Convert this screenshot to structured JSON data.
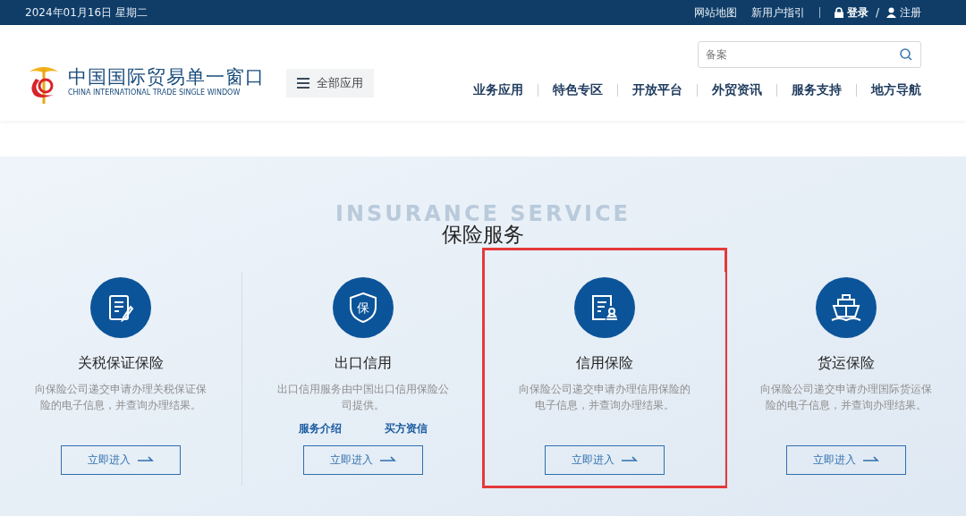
{
  "top_bar": {
    "date": "2024年01月16日 星期二",
    "links": [
      "网站地图",
      "新用户指引"
    ],
    "login": "登录",
    "separator": "/",
    "register": "注册"
  },
  "header": {
    "brand_title": "中国国际贸易单一窗口",
    "brand_subtitle": "CHINA INTERNATIONAL TRADE SINGLE WINDOW",
    "menu_button": "全部应用",
    "search": {
      "placeholder": "备案"
    },
    "nav": [
      {
        "label": "业务应用"
      },
      {
        "label": "特色专区"
      },
      {
        "label": "开放平台"
      },
      {
        "label": "外贸资讯"
      },
      {
        "label": "服务支持"
      },
      {
        "label": "地方导航"
      }
    ]
  },
  "section": {
    "background_title": "INSURANCE SERVICE",
    "title": "保险服务",
    "cards": [
      {
        "kind": "document",
        "title": "关税保证保险",
        "description": "向保险公司递交申请办理关税保证保险的电子信息，并查询办理结果。",
        "button": "立即进入",
        "highlighted": false
      },
      {
        "kind": "shield",
        "icon_text": "保",
        "title": "出口信用",
        "description": "出口信用服务由中国出口信用保险公司提供。",
        "links": [
          "服务介绍",
          "买方资信"
        ],
        "button": "立即进入",
        "highlighted": false
      },
      {
        "kind": "stamp",
        "title": "信用保险",
        "description": "向保险公司递交申请办理信用保险的电子信息，并查询办理结果。",
        "button": "立即进入",
        "highlighted": true
      },
      {
        "kind": "ship",
        "title": "货运保险",
        "description": "向保险公司递交申请办理国际货运保险的电子信息，并查询办理结果。",
        "button": "立即进入",
        "highlighted": false
      }
    ]
  }
}
